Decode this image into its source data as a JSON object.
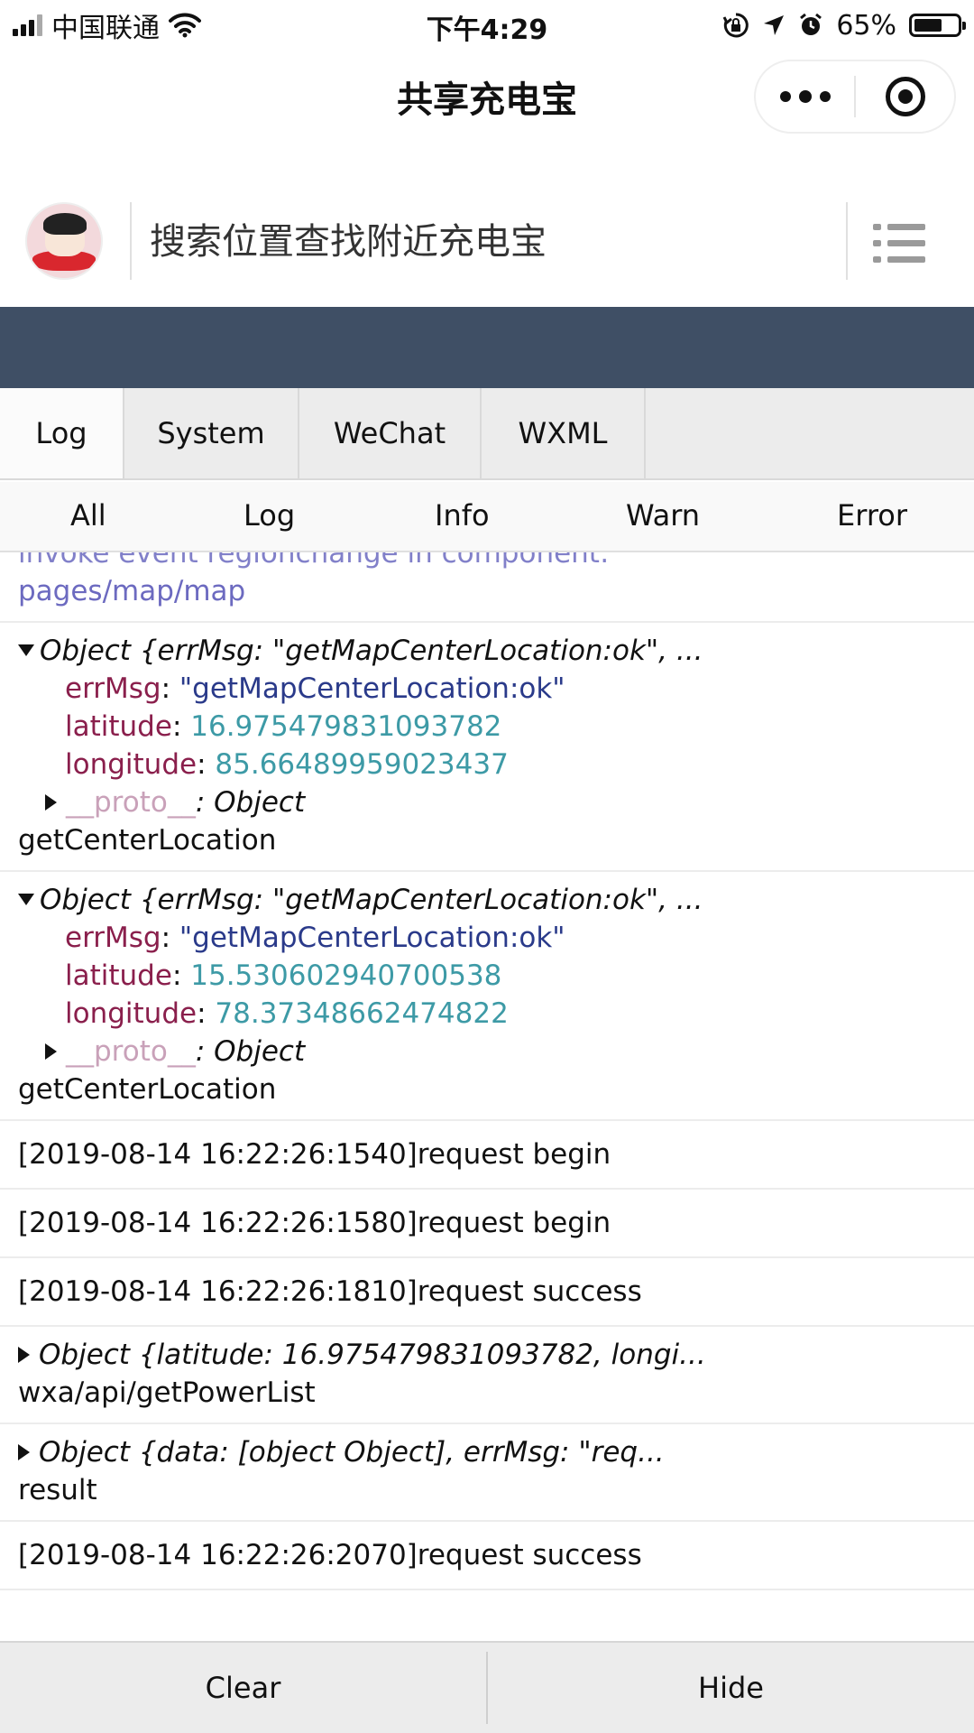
{
  "status_bar": {
    "carrier": "中国联通",
    "time": "下午4:29",
    "battery": "65%",
    "battery_level": 0.65
  },
  "nav": {
    "title": "共享充电宝"
  },
  "search": {
    "placeholder": "搜索位置查找附近充电宝"
  },
  "console_tabs": [
    "Log",
    "System",
    "WeChat",
    "WXML"
  ],
  "filters": [
    "All",
    "Log",
    "Info",
    "Warn",
    "Error"
  ],
  "logs": {
    "e0": {
      "cut": "invoke event regionchange in component:",
      "line": "pages/map/map"
    },
    "e1": {
      "summary": "Object {errMsg: \"getMapCenterLocation:ok\", ...",
      "errMsg_key": "errMsg",
      "errMsg_val": "\"getMapCenterLocation:ok\"",
      "lat_key": "latitude",
      "lat_val": "16.975479831093782",
      "lng_key": "longitude",
      "lng_val": "85.66489959023437",
      "proto_key": "__proto__",
      "proto_val": ": Object",
      "label": "getCenterLocation"
    },
    "e2": {
      "summary": "Object {errMsg: \"getMapCenterLocation:ok\", ...",
      "errMsg_key": "errMsg",
      "errMsg_val": "\"getMapCenterLocation:ok\"",
      "lat_key": "latitude",
      "lat_val": "15.530602940700538",
      "lng_key": "longitude",
      "lng_val": "78.37348662474822",
      "proto_key": "__proto__",
      "proto_val": ": Object",
      "label": "getCenterLocation"
    },
    "e3": "[2019-08-14 16:22:26:1540]request begin",
    "e4": "[2019-08-14 16:22:26:1580]request begin",
    "e5": "[2019-08-14 16:22:26:1810]request success",
    "e6": {
      "summary": "Object {latitude: 16.975479831093782, longi...",
      "label": "wxa/api/getPowerList"
    },
    "e7": {
      "summary": "Object {data: [object Object], errMsg: \"req...",
      "label": "result"
    },
    "e8": "[2019-08-14 16:22:26:2070]request success"
  },
  "bottom": {
    "clear": "Clear",
    "hide": "Hide"
  }
}
